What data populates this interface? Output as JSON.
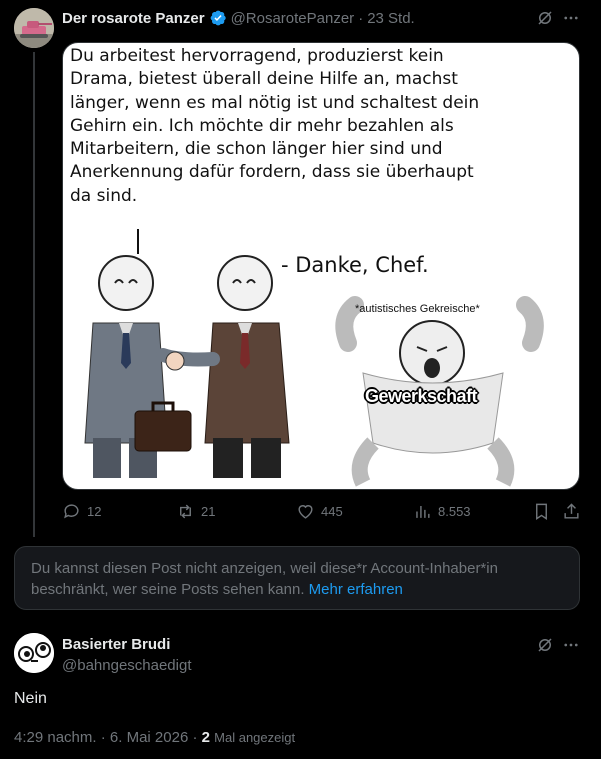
{
  "tweet": {
    "author_name": "Der rosarote Panzer",
    "handle": "@RosarotePanzer",
    "separator": "·",
    "time": "23 Std.",
    "meme": {
      "main_text": "Du arbeitest hervorragend, produzierst kein Drama, bietest überall deine Hilfe an, machst länger, wenn es mal nötig ist und schaltest dein Gehirn ein. Ich möchte dir mehr bezahlen als Mitarbeitern, die schon länger hier sind und Anerkennung dafür fordern, dass sie überhaupt da sind.",
      "reply_text": "- Danke, Chef.",
      "caption_text": "*autistisches Gekreische*",
      "label_text": "Gewerkschaft"
    },
    "actions": {
      "replies": "12",
      "reposts": "21",
      "likes": "445",
      "views": "8.553"
    }
  },
  "restricted_notice": {
    "text": "Du kannst diesen Post nicht anzeigen, weil diese*r Account-Inhaber*in beschränkt, wer seine Posts sehen kann.",
    "link": "Mehr erfahren"
  },
  "reply": {
    "author_name": "Basierter Brudi",
    "handle": "@bahngeschaedigt",
    "text": "Nein",
    "time": "4:29 nachm.",
    "date": "6. Mai 2026",
    "separator": "·",
    "view_count": "2",
    "view_label": "Mal angezeigt"
  },
  "colors": {
    "background": "#000000",
    "text": "#e7e9ea",
    "muted": "#71767b",
    "accent": "#1d9bf0",
    "border": "#2f3336"
  }
}
